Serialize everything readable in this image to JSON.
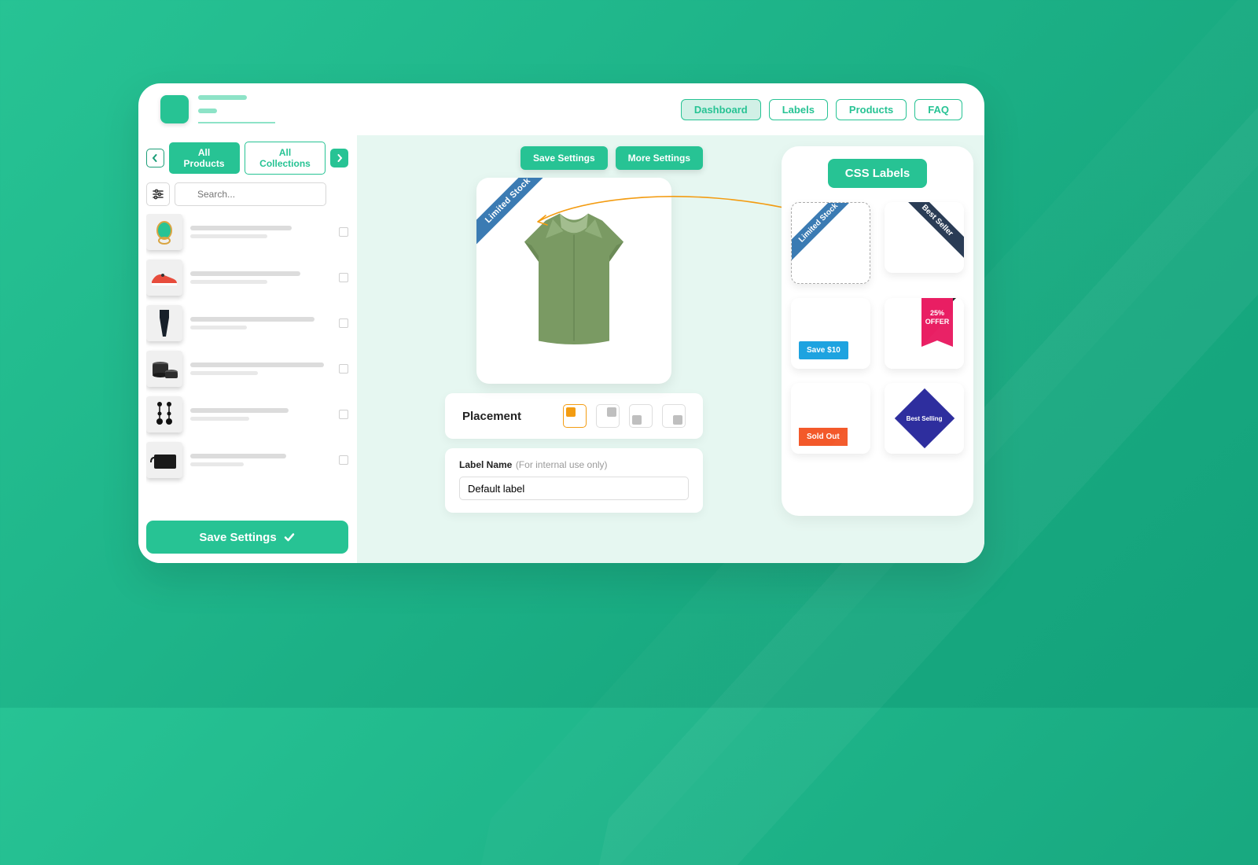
{
  "nav": {
    "dashboard": "Dashboard",
    "labels": "Labels",
    "products": "Products",
    "faq": "FAQ"
  },
  "sidebar": {
    "tab_products": "All Products",
    "tab_collections": "All Collections",
    "search_placeholder": "Search...",
    "save_btn": "Save Settings"
  },
  "center": {
    "save": "Save Settings",
    "more": "More Settings",
    "ribbon_text": "Limited Stock",
    "placement_title": "Placement",
    "label_name_label": "Label Name",
    "label_name_hint": "(For internal use only)",
    "label_name_value": "Default label"
  },
  "right": {
    "title": "CSS Labels",
    "opt_limited": "Limited Stock",
    "opt_bestseller": "Best Seller",
    "opt_save10": "Save $10",
    "opt_offer_line1": "25%",
    "opt_offer_line2": "OFFER",
    "opt_soldout": "Sold Out",
    "opt_bestselling": "Best Selling"
  }
}
